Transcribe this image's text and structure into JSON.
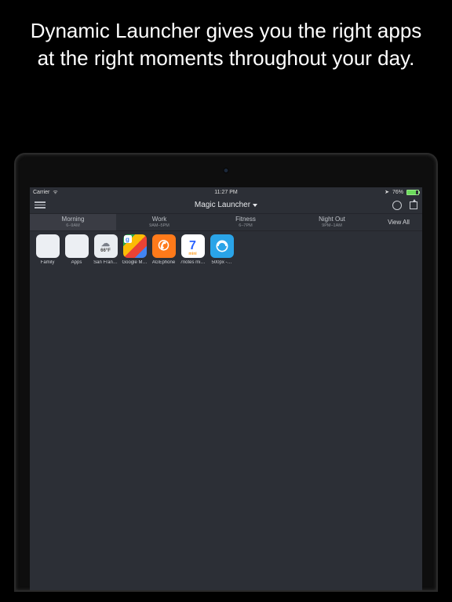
{
  "headline": "Dynamic Launcher gives you the right apps at the right moments throughout your day.",
  "statusbar": {
    "carrier": "Carrier",
    "time": "11:27 PM",
    "battery_pct": "76%"
  },
  "navbar": {
    "title": "Magic Launcher"
  },
  "tabs": [
    {
      "label": "Morning",
      "sub": "6–9AM",
      "active": true
    },
    {
      "label": "Work",
      "sub": "9AM–5PM",
      "active": false
    },
    {
      "label": "Fitness",
      "sub": "6–7PM",
      "active": false
    },
    {
      "label": "Night Out",
      "sub": "9PM–1AM",
      "active": false
    }
  ],
  "view_all": "View All",
  "apps": [
    {
      "label": "Family",
      "type": "folder"
    },
    {
      "label": "Apps",
      "type": "folder"
    },
    {
      "label": "San Fran…",
      "type": "weather",
      "temp": "66°F"
    },
    {
      "label": "Google M…",
      "type": "gmaps"
    },
    {
      "label": "AGEphone",
      "type": "age"
    },
    {
      "label": "7notes mi…",
      "type": "sevennotes"
    },
    {
      "label": "500px -…",
      "type": "500px"
    }
  ]
}
